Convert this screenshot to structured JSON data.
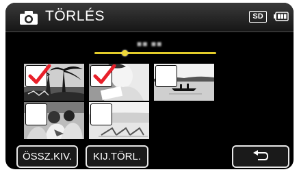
{
  "header": {
    "title": "TÖRLÉS",
    "media_badge": "SD",
    "camera_icon": "camera-icon",
    "battery_icon": "battery-icon"
  },
  "slider": {
    "date_label": "■■ ■■",
    "position": 0.25
  },
  "thumbnails": [
    {
      "name": "thumbnail-1",
      "selected": true
    },
    {
      "name": "thumbnail-2",
      "selected": true
    },
    {
      "name": "thumbnail-3",
      "selected": false
    },
    {
      "name": "thumbnail-4",
      "selected": false
    },
    {
      "name": "thumbnail-5",
      "selected": false
    }
  ],
  "buttons": {
    "select_all": "ÖSSZ.KIV.",
    "delete_selected": "KIJ.TÖRL.",
    "back_icon": "return-arrow-icon"
  },
  "colors": {
    "slider": "#e3cc2a",
    "checkmark": "#e8202a",
    "background": "#000000"
  }
}
